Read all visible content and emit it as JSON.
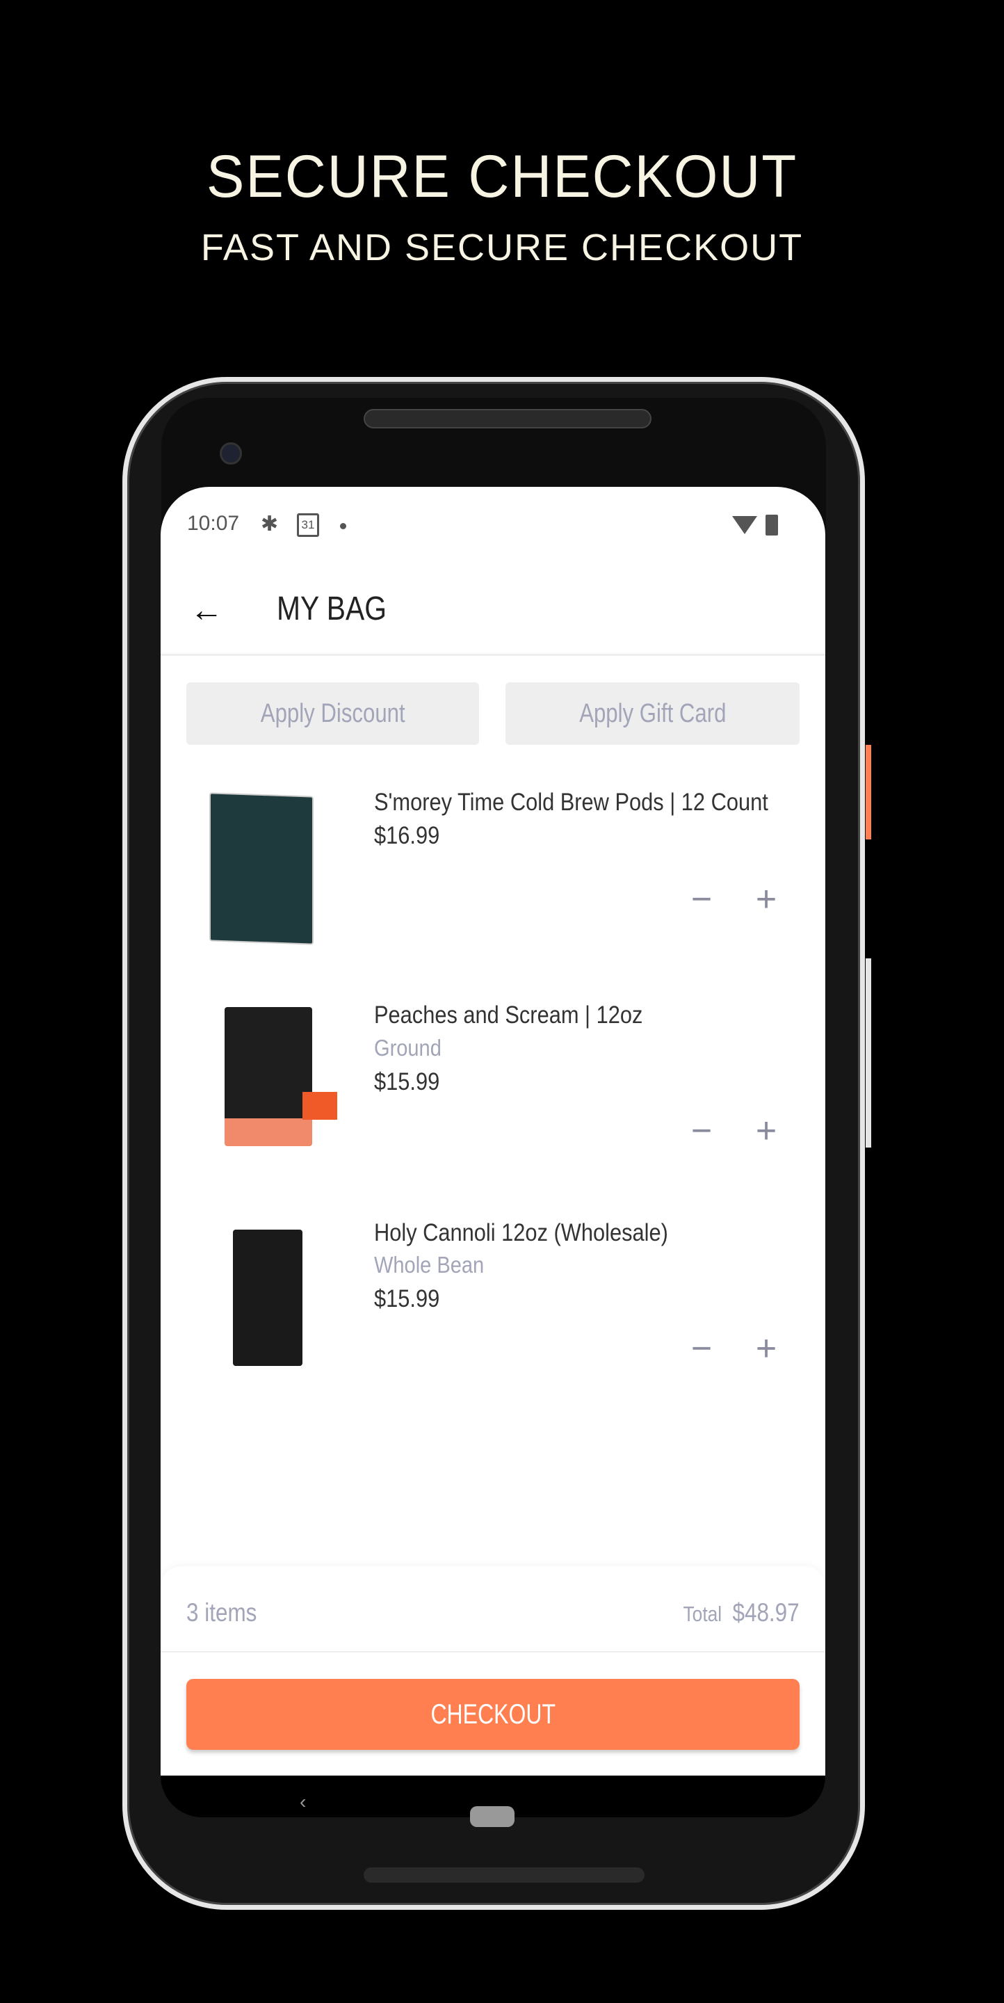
{
  "hero": {
    "title": "SECURE CHECKOUT",
    "subtitle": "FAST AND SECURE CHECKOUT"
  },
  "status_bar": {
    "time": "10:07",
    "calendar_day": "31"
  },
  "header": {
    "title": "MY BAG"
  },
  "actions": {
    "discount": "Apply Discount",
    "gift_card": "Apply Gift Card"
  },
  "items": [
    {
      "name": "S'morey Time Cold Brew Pods | 12 Count",
      "variant": "",
      "price": "$16.99",
      "image_color": "#1f3a3d"
    },
    {
      "name": "Peaches and Scream | 12oz",
      "variant": "Ground",
      "price": "$15.99",
      "image_color": "#f08a6a"
    },
    {
      "name": "Holy Cannoli 12oz (Wholesale)",
      "variant": "Whole Bean",
      "price": "$15.99",
      "image_color": "#1a1a1a"
    }
  ],
  "footer": {
    "count": "3 items",
    "total_label": "Total",
    "total_value": "$48.97",
    "checkout": "CHECKOUT"
  },
  "colors": {
    "accent": "#ff7f50",
    "muted": "#a2a5b8"
  }
}
